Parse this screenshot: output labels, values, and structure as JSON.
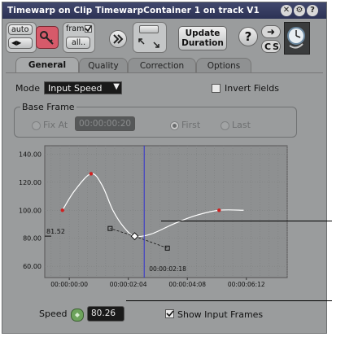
{
  "window": {
    "title": "Timewarp on Clip TimewarpContainer 1 on track V1"
  },
  "toolbar": {
    "auto_label": "auto",
    "frame_label": "frame",
    "all_label": "all..",
    "update_label": "Update",
    "duration_label": "Duration",
    "help_label": "?",
    "c_s_label": "S"
  },
  "tabs": [
    {
      "label": "General",
      "active": true
    },
    {
      "label": "Quality",
      "active": false
    },
    {
      "label": "Correction",
      "active": false
    },
    {
      "label": "Options",
      "active": false
    }
  ],
  "mode": {
    "label": "Mode",
    "value": "Input Speed"
  },
  "invert_fields": {
    "label": "Invert Fields",
    "checked": false
  },
  "base_frame": {
    "group_label": "Base Frame",
    "fix_at_label": "Fix At",
    "fix_at_value": "00:00:00:20",
    "first_label": "First",
    "last_label": "Last",
    "selected": "First"
  },
  "chart_data": {
    "type": "line",
    "y_ticks": [
      "140.00",
      "120.00",
      "100.00",
      "80.00",
      "60.00"
    ],
    "ylim": [
      52,
      146
    ],
    "x_ticks": [
      {
        "label": "00:00:00:00",
        "t": 0
      },
      {
        "label": "00:00:02:04",
        "t": 2.167
      },
      {
        "label": "00:00:04:08",
        "t": 4.333
      },
      {
        "label": "00:00:06:12",
        "t": 6.5
      }
    ],
    "xlim": [
      -0.9,
      8.0
    ],
    "current_time": {
      "label": "00:00:02:18",
      "t": 2.75
    },
    "current_value_label": "81.52",
    "keyframes": [
      {
        "t": -0.25,
        "v": 100
      },
      {
        "t": 0.8,
        "v": 126
      },
      {
        "t": 2.4,
        "v": 81.5
      },
      {
        "t": 5.5,
        "v": 100
      }
    ],
    "curve": [
      {
        "t": -0.25,
        "v": 100
      },
      {
        "t": 0.2,
        "v": 114
      },
      {
        "t": 0.8,
        "v": 126
      },
      {
        "t": 1.2,
        "v": 118
      },
      {
        "t": 1.6,
        "v": 100
      },
      {
        "t": 2.0,
        "v": 88
      },
      {
        "t": 2.4,
        "v": 81.5
      },
      {
        "t": 3.0,
        "v": 83
      },
      {
        "t": 3.8,
        "v": 90
      },
      {
        "t": 4.6,
        "v": 96
      },
      {
        "t": 5.5,
        "v": 100
      },
      {
        "t": 6.4,
        "v": 100
      }
    ],
    "tangent_handles": [
      {
        "t": 1.5,
        "v": 87
      },
      {
        "t": 3.6,
        "v": 73
      }
    ],
    "grid": true
  },
  "speed": {
    "label": "Speed",
    "value": "80.26"
  },
  "show_input_frames": {
    "label": "Show Input Frames",
    "checked": true
  },
  "colors": {
    "window_bg": "#9a9c9d",
    "title_bar": "#2c3255",
    "graph_bg": "#8e9091",
    "curve": "#ffffff",
    "keyframe": "#d02020",
    "playhead": "#3030d0"
  }
}
